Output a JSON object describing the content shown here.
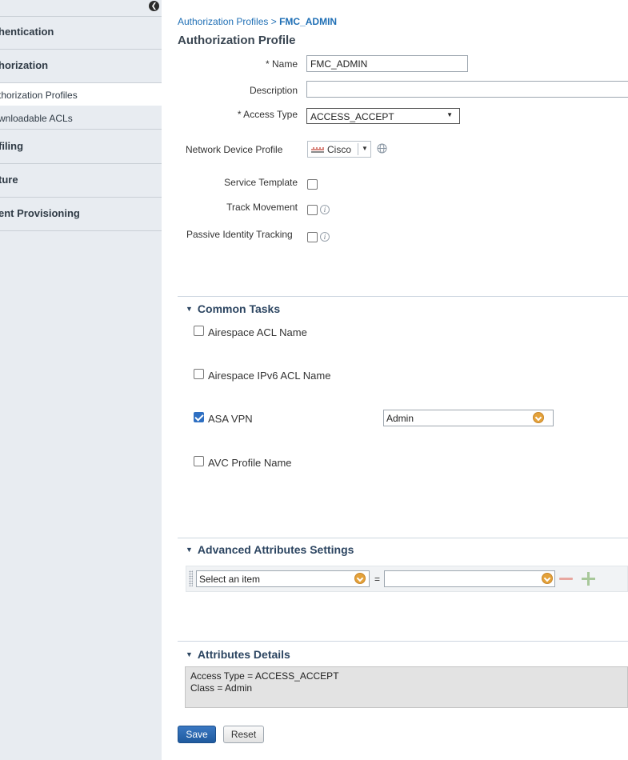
{
  "sidebar": {
    "items": [
      {
        "label": "hentication"
      },
      {
        "label": "horization"
      },
      {
        "label": "thorization Profiles",
        "active": true
      },
      {
        "label": "wnloadable ACLs"
      },
      {
        "label": "filing"
      },
      {
        "label": "ture"
      },
      {
        "label": "ent Provisioning"
      }
    ],
    "collapse_icon": "chevron-left-circle-icon"
  },
  "breadcrumb": {
    "parent": "Authorization Profiles",
    "separator": " > ",
    "current": "FMC_ADMIN"
  },
  "page_title": "Authorization Profile",
  "form": {
    "name_label": "* Name",
    "name_value": "FMC_ADMIN",
    "description_label": "Description",
    "description_value": "",
    "access_type_label": "* Access Type",
    "access_type_value": "ACCESS_ACCEPT",
    "ndp_label": "Network Device Profile",
    "ndp_value": "Cisco",
    "service_template_label": "Service Template",
    "track_movement_label": "Track Movement",
    "passive_identity_label": "Passive Identity Tracking"
  },
  "common_tasks": {
    "title": "Common Tasks",
    "items": [
      {
        "label": "Airespace ACL Name",
        "checked": false
      },
      {
        "label": "Airespace IPv6 ACL Name",
        "checked": false
      },
      {
        "label": "ASA VPN",
        "checked": true,
        "value": "Admin"
      },
      {
        "label": "AVC Profile Name",
        "checked": false
      }
    ]
  },
  "advanced": {
    "title": "Advanced Attributes Settings",
    "select_placeholder": "Select an item",
    "equals": "=",
    "value": ""
  },
  "details": {
    "title": "Attributes Details",
    "lines": [
      "Access Type = ACCESS_ACCEPT",
      "Class = Admin"
    ]
  },
  "buttons": {
    "save": "Save",
    "reset": "Reset"
  },
  "colors": {
    "accent": "#1f6fb5",
    "section_title": "#2c4561",
    "dropdown": "#e4a23a"
  }
}
